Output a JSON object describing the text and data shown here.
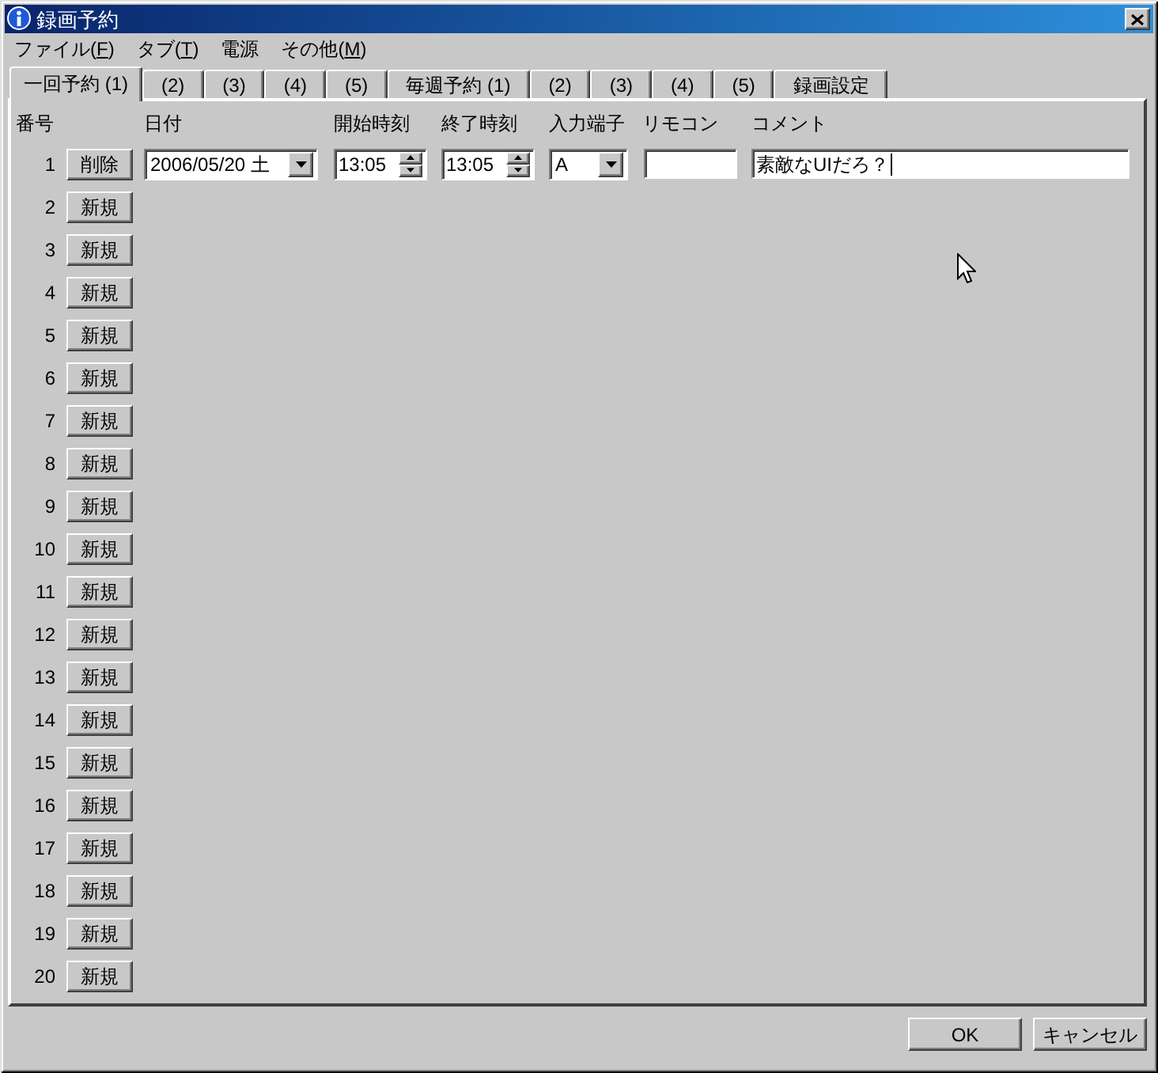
{
  "window": {
    "title": "録画予約"
  },
  "menu": [
    {
      "text": "ファイル(",
      "accel": "F",
      "after": ")"
    },
    {
      "text": "タブ(",
      "accel": "T",
      "after": ")"
    },
    {
      "text": "電源"
    },
    {
      "text": "その他(",
      "accel": "M",
      "after": ")"
    }
  ],
  "tabs": [
    {
      "label": "一回予約 (1)",
      "selected": true
    },
    {
      "label": "(2)",
      "selected": false
    },
    {
      "label": "(3)",
      "selected": false
    },
    {
      "label": "(4)",
      "selected": false
    },
    {
      "label": "(5)",
      "selected": false
    },
    {
      "label": "毎週予約 (1)",
      "selected": false
    },
    {
      "label": "(2)",
      "selected": false
    },
    {
      "label": "(3)",
      "selected": false
    },
    {
      "label": "(4)",
      "selected": false
    },
    {
      "label": "(5)",
      "selected": false
    },
    {
      "label": "録画設定",
      "selected": false
    }
  ],
  "columns": [
    "番号",
    "日付",
    "開始時刻",
    "終了時刻",
    "入力端子",
    "リモコン",
    "コメント"
  ],
  "rows": [
    {
      "number": "1",
      "kind": "entry",
      "button": "削除",
      "date": "2006/05/20 土",
      "start_time": "13:05",
      "end_time": "13:05",
      "input": "A",
      "comment": "素敵なUIだろ？",
      "focused": true
    },
    {
      "number": "2",
      "kind": "empty",
      "button": "新規"
    },
    {
      "number": "3",
      "kind": "empty",
      "button": "新規"
    },
    {
      "number": "4",
      "kind": "empty",
      "button": "新規"
    },
    {
      "number": "5",
      "kind": "empty",
      "button": "新規"
    },
    {
      "number": "6",
      "kind": "empty",
      "button": "新規"
    },
    {
      "number": "7",
      "kind": "empty",
      "button": "新規"
    },
    {
      "number": "8",
      "kind": "empty",
      "button": "新規"
    },
    {
      "number": "9",
      "kind": "empty",
      "button": "新規"
    },
    {
      "number": "10",
      "kind": "empty",
      "button": "新規"
    },
    {
      "number": "11",
      "kind": "empty",
      "button": "新規"
    },
    {
      "number": "12",
      "kind": "empty",
      "button": "新規"
    },
    {
      "number": "13",
      "kind": "empty",
      "button": "新規"
    },
    {
      "number": "14",
      "kind": "empty",
      "button": "新規"
    },
    {
      "number": "15",
      "kind": "empty",
      "button": "新規"
    },
    {
      "number": "16",
      "kind": "empty",
      "button": "新規"
    },
    {
      "number": "17",
      "kind": "empty",
      "button": "新規"
    },
    {
      "number": "18",
      "kind": "empty",
      "button": "新規"
    },
    {
      "number": "19",
      "kind": "empty",
      "button": "新規"
    },
    {
      "number": "20",
      "kind": "empty",
      "button": "新規"
    }
  ],
  "buttons": [
    "OK",
    "キャンセル"
  ]
}
